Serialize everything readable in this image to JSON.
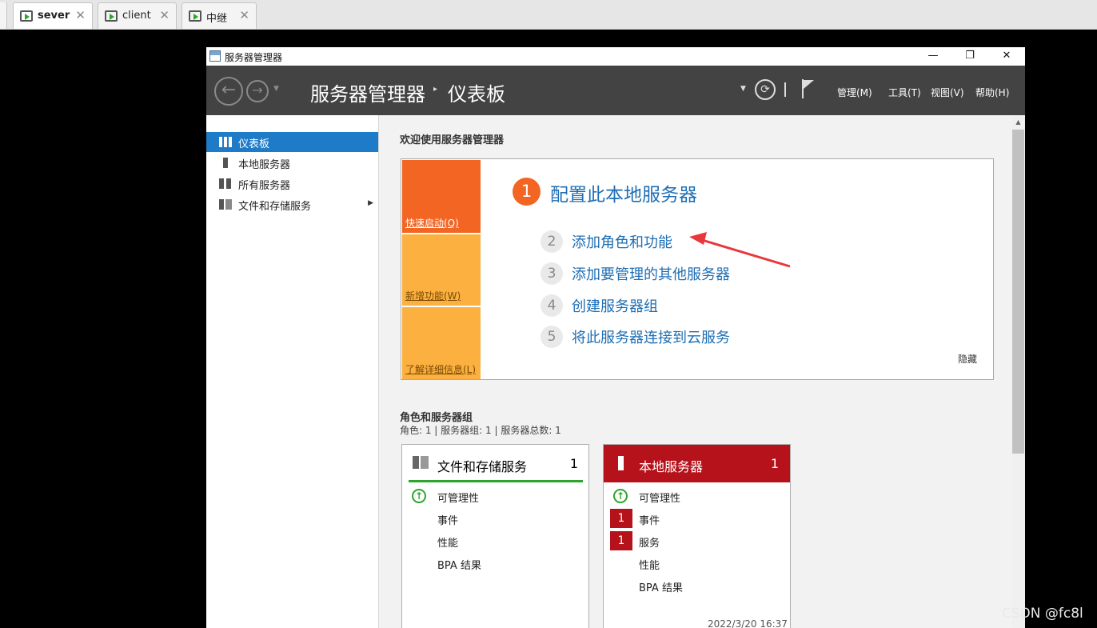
{
  "host_tabs": [
    {
      "label": "sever",
      "active": true
    },
    {
      "label": "client",
      "active": false
    },
    {
      "label": "中继",
      "active": false
    }
  ],
  "window": {
    "title": "服务器管理器",
    "minimize": "—",
    "restore": "❐",
    "close": "✕"
  },
  "header": {
    "app_title": "服务器管理器",
    "separator": "▸",
    "page_title": "仪表板",
    "menus": {
      "manage": "管理(M)",
      "tools": "工具(T)",
      "view": "视图(V)",
      "help": "帮助(H)"
    },
    "refresh_icon": "refresh-icon",
    "flag_icon": "notification-flag-icon"
  },
  "sidebar": {
    "items": [
      {
        "label": "仪表板",
        "icon": "dashboard-icon",
        "active": true
      },
      {
        "label": "本地服务器",
        "icon": "server-icon"
      },
      {
        "label": "所有服务器",
        "icon": "servers-icon"
      },
      {
        "label": "文件和存储服务",
        "icon": "storage-icon",
        "has_submenu": true
      }
    ]
  },
  "welcome": {
    "title": "欢迎使用服务器管理器",
    "tiles": {
      "quick_start": "快速启动(Q)",
      "whats_new": "新增功能(W)",
      "learn_more": "了解详细信息(L)"
    },
    "step1_num": "1",
    "step1_label": "配置此本地服务器",
    "steps": [
      {
        "num": "2",
        "label": "添加角色和功能"
      },
      {
        "num": "3",
        "label": "添加要管理的其他服务器"
      },
      {
        "num": "4",
        "label": "创建服务器组"
      },
      {
        "num": "5",
        "label": "将此服务器连接到云服务"
      }
    ],
    "hide": "隐藏"
  },
  "roles": {
    "title": "角色和服务器组",
    "summary": "角色: 1 | 服务器组: 1 | 服务器总数: 1",
    "cards": [
      {
        "name": "文件和存储服务",
        "count": "1",
        "rows": [
          "可管理性",
          "事件",
          "性能",
          "BPA 结果"
        ]
      },
      {
        "name": "本地服务器",
        "count": "1",
        "rows": [
          "可管理性",
          "事件",
          "服务",
          "性能",
          "BPA 结果"
        ],
        "badge_events": "1",
        "badge_services": "1",
        "timestamp": "2022/3/20 16:37"
      }
    ]
  },
  "colors": {
    "header_bg": "#434343",
    "accent_blue": "#1e7bc8",
    "link_blue": "#1e6eb4",
    "tile_orange": "#f26522",
    "tile_amber": "#fbb040",
    "card_red": "#b5121b",
    "ok_green": "#2da52d",
    "annotation_red": "#e8383d"
  },
  "watermark": "CSDN @fc8l"
}
